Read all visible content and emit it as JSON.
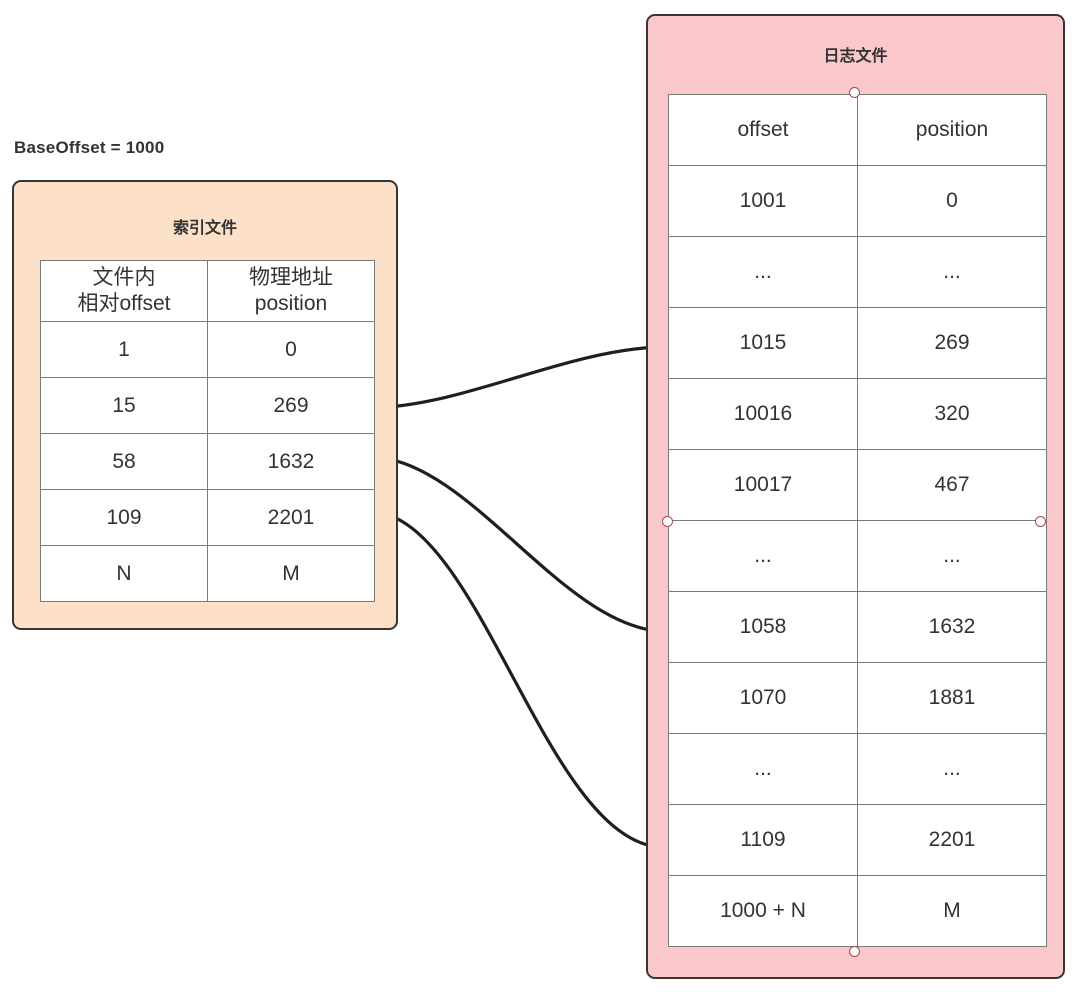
{
  "diagram": {
    "base_offset_label": "BaseOffset = 1000",
    "index_panel": {
      "title": "索引文件",
      "accent_color": "#fce0c8",
      "border_color": "#3b3330",
      "headers": {
        "col1_line1": "文件内",
        "col1_line2": "相对offset",
        "col2_line1": "物理地址",
        "col2_line2": "position"
      },
      "rows": [
        {
          "offset": "1",
          "position": "0"
        },
        {
          "offset": "15",
          "position": "269"
        },
        {
          "offset": "58",
          "position": "1632"
        },
        {
          "offset": "109",
          "position": "2201"
        },
        {
          "offset": "N",
          "position": "M"
        }
      ]
    },
    "log_panel": {
      "title": "日志文件",
      "accent_color": "#fac8ca",
      "border_color": "#3b3330",
      "headers": {
        "col1": "offset",
        "col2": "position"
      },
      "rows": [
        {
          "offset": "1001",
          "position": "0"
        },
        {
          "offset": "...",
          "position": "..."
        },
        {
          "offset": "1015",
          "position": "269"
        },
        {
          "offset": "10016",
          "position": "320"
        },
        {
          "offset": "10017",
          "position": "467"
        },
        {
          "offset": "...",
          "position": "..."
        },
        {
          "offset": "1058",
          "position": "1632"
        },
        {
          "offset": "1070",
          "position": "1881"
        },
        {
          "offset": "...",
          "position": "..."
        },
        {
          "offset": "1109",
          "position": "2201"
        },
        {
          "offset": "1000 + N",
          "position": "M"
        }
      ]
    },
    "connectors": [
      {
        "from_row": "15 / 269",
        "to_row": "1015 / 269"
      },
      {
        "from_row": "58 / 1632",
        "to_row": "1058 / 1632"
      },
      {
        "from_row": "109 / 2201",
        "to_row": "1109 / 2201"
      }
    ]
  }
}
